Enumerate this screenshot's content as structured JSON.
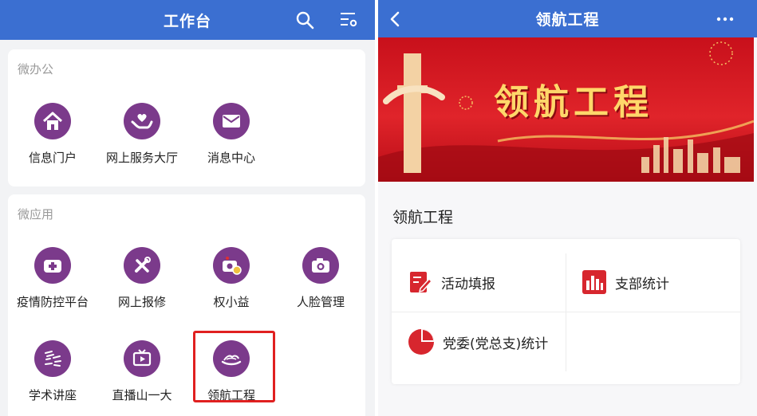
{
  "left": {
    "header": {
      "title": "工作台",
      "search_icon": "search-icon",
      "settings_icon": "settings-icon"
    },
    "office": {
      "title": "微办公",
      "items": [
        {
          "label": "信息门户",
          "icon": "home-icon"
        },
        {
          "label": "网上服务大厅",
          "icon": "hands-heart-icon"
        },
        {
          "label": "消息中心",
          "icon": "envelope-icon"
        }
      ]
    },
    "apps": {
      "title": "微应用",
      "items": [
        {
          "label": "疫情防控平台",
          "icon": "medical-kit-icon"
        },
        {
          "label": "网上报修",
          "icon": "tools-icon"
        },
        {
          "label": "权小益",
          "icon": "camera-search-icon"
        },
        {
          "label": "人脸管理",
          "icon": "camera-icon"
        },
        {
          "label": "学术讲座",
          "icon": "lecture-icon"
        },
        {
          "label": "直播山一大",
          "icon": "tv-icon"
        },
        {
          "label": "领航工程",
          "icon": "ship-icon"
        }
      ]
    }
  },
  "right": {
    "header": {
      "title": "领航工程",
      "back_icon": "back-icon",
      "more_icon": "more-icon"
    },
    "banner_text": "领航工程",
    "section_title": "领航工程",
    "grid": [
      {
        "label": "活动填报",
        "icon": "edit-icon"
      },
      {
        "label": "支部统计",
        "icon": "bar-chart-icon"
      },
      {
        "label": "党委(党总支)统计",
        "icon": "pie-chart-icon"
      }
    ],
    "colors": {
      "header": "#3b6fd1",
      "icon_purple": "#7b3a8b",
      "accent_red": "#d7262e",
      "highlight": "#e02020"
    }
  }
}
